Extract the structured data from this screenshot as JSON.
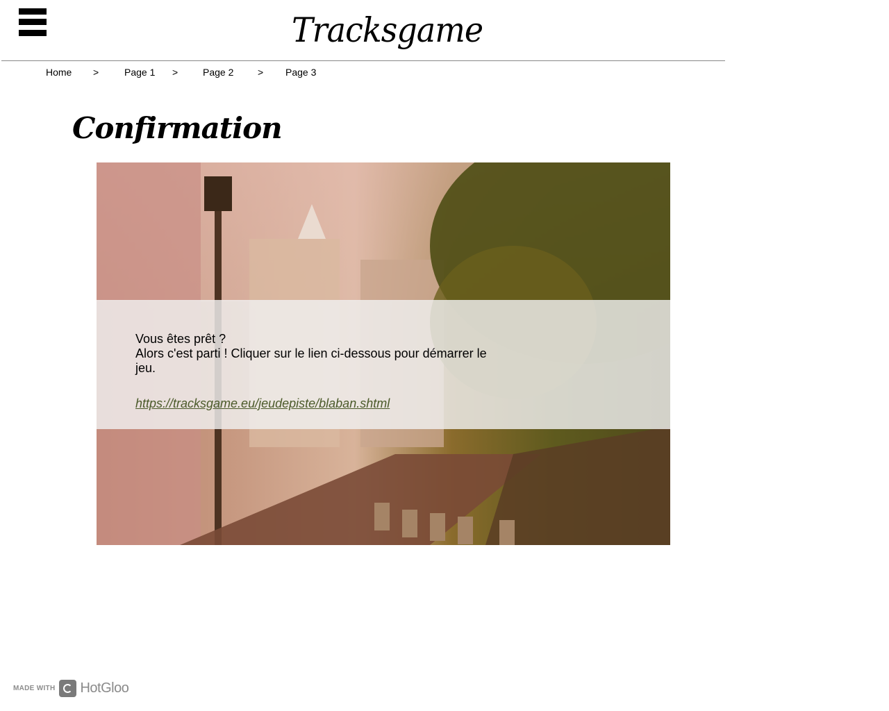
{
  "header": {
    "site_title": "Tracksgame",
    "menu_icon": "hamburger-menu-icon"
  },
  "breadcrumb": {
    "home": "Home",
    "page1": "Page 1",
    "page2": "Page 2",
    "page3": "Page 3",
    "separator": ">"
  },
  "main": {
    "page_title": "Confirmation",
    "message_line1": "Vous êtes prêt ?",
    "message_line2": "Alors c'est parti ! Cliquer sur le lien ci-dessous pour démarrer le jeu.",
    "game_link": "https://tracksgame.eu/jeudepiste/blaban.shtml",
    "link_color": "#4b5a2a"
  },
  "footer": {
    "made_with": "MADE WITH",
    "brand": "HotGloo"
  }
}
